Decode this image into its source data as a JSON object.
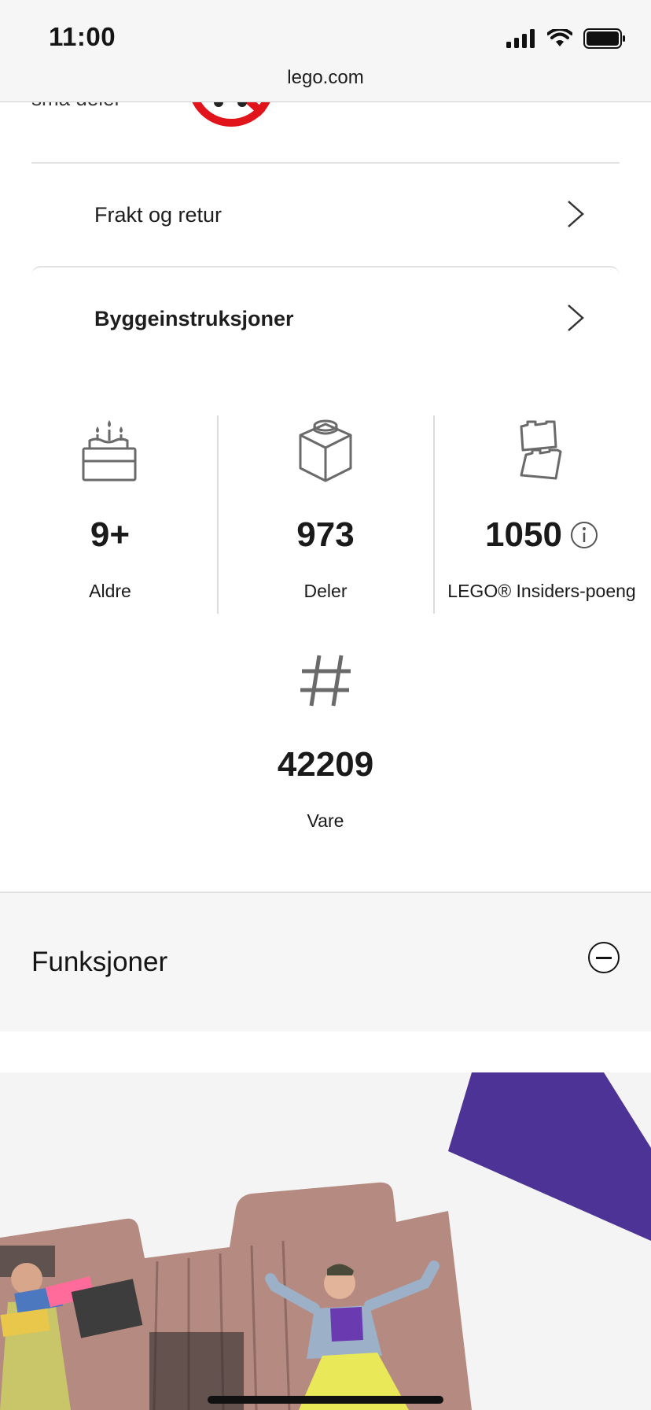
{
  "status_bar": {
    "time": "11:00"
  },
  "browser": {
    "url": "lego.com"
  },
  "partial": {
    "text": "små deler"
  },
  "rows": [
    {
      "label": "Frakt og retur"
    },
    {
      "label": "Byggeinstruksjoner"
    }
  ],
  "stats": {
    "age": {
      "value": "9+",
      "label": "Aldre",
      "icon": "cake-icon"
    },
    "pieces": {
      "value": "973",
      "label": "Deler",
      "icon": "brick-icon"
    },
    "points": {
      "value": "1050",
      "label": "LEGO® Insiders-poeng",
      "icon": "bricks-stack-icon"
    },
    "item": {
      "value": "42209",
      "label": "Vare",
      "icon": "hash-icon"
    }
  },
  "features": {
    "title": "Funksjoner"
  },
  "colors": {
    "accent_purple": "#4e3396",
    "warning_red": "#e1141b"
  }
}
